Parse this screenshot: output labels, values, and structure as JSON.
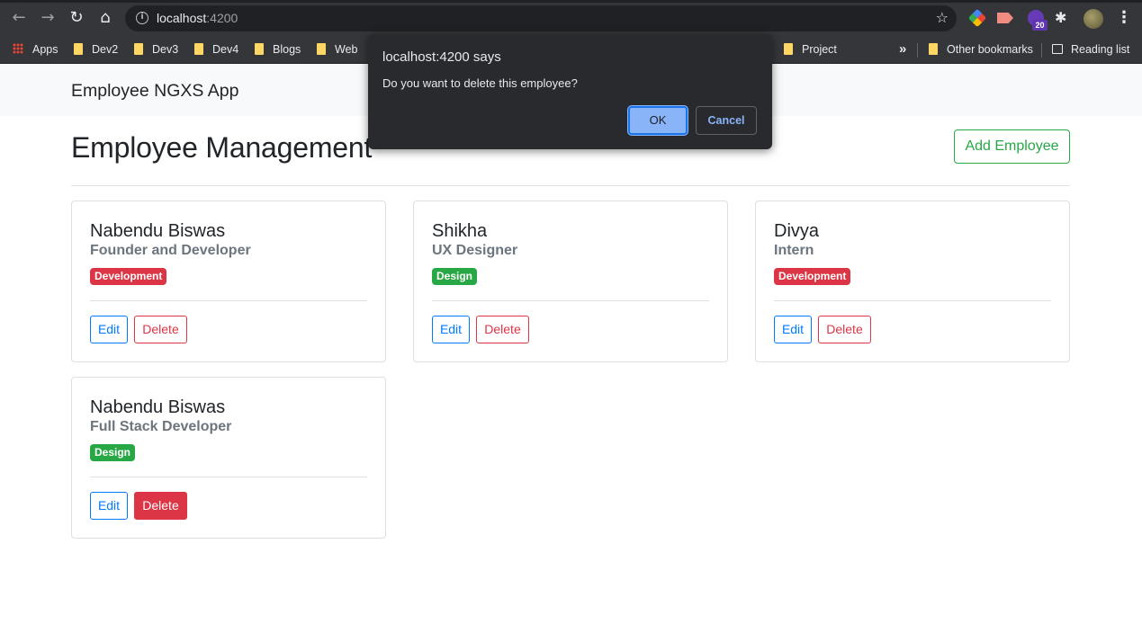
{
  "browser": {
    "url_host": "localhost",
    "url_port": ":4200",
    "extension_badge": "20",
    "bookmarks": [
      {
        "label": "Apps"
      },
      {
        "label": "Dev2"
      },
      {
        "label": "Dev3"
      },
      {
        "label": "Dev4"
      },
      {
        "label": "Blogs"
      },
      {
        "label": "Web"
      },
      {
        "label": "Project"
      }
    ],
    "overflow": "»",
    "other_bookmarks": "Other bookmarks",
    "reading_list": "Reading list"
  },
  "dialog": {
    "title": "localhost:4200 says",
    "message": "Do you want to delete this employee?",
    "ok_label": "OK",
    "cancel_label": "Cancel"
  },
  "app": {
    "brand": "Employee NGXS App",
    "title": "Employee Management",
    "add_label": "Add Employee",
    "edit_label": "Edit",
    "delete_label": "Delete",
    "employees": [
      {
        "name": "Nabendu Biswas",
        "role": "Founder and Developer",
        "dept": "Development",
        "dept_color": "#dc3545"
      },
      {
        "name": "Shikha",
        "role": "UX Designer",
        "dept": "Design",
        "dept_color": "#28a745"
      },
      {
        "name": "Divya",
        "role": "Intern",
        "dept": "Development",
        "dept_color": "#dc3545"
      },
      {
        "name": "Nabendu Biswas",
        "role": "Full Stack Developer",
        "dept": "Design",
        "dept_color": "#28a745"
      }
    ]
  },
  "colors": {
    "primary": "#007bff",
    "danger": "#dc3545",
    "success": "#28a745",
    "chrome_dark": "#35363a"
  }
}
